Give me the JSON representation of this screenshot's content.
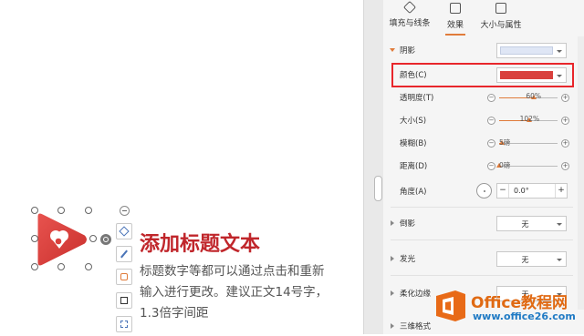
{
  "tabs": [
    {
      "label": "填充与线条",
      "active": false
    },
    {
      "label": "效果",
      "active": true
    },
    {
      "label": "大小与属性",
      "active": false
    }
  ],
  "shadow": {
    "section_label": "阴影",
    "color_label": "颜色(C)",
    "color_value": "#d9403d",
    "transparency": {
      "label": "透明度(T)",
      "value_text": "60%",
      "value": 60
    },
    "size": {
      "label": "大小(S)",
      "value_text": "102%",
      "value": 102
    },
    "blur": {
      "label": "模糊(B)",
      "value_text": "5磅",
      "value": 5
    },
    "distance": {
      "label": "距离(D)",
      "value_text": "0磅",
      "value": 0
    },
    "angle": {
      "label": "角度(A)",
      "value": "0.0°"
    }
  },
  "sections": [
    {
      "label": "倒影",
      "value": "无"
    },
    {
      "label": "发光",
      "value": "无"
    },
    {
      "label": "柔化边缘",
      "value": "无"
    },
    {
      "label": "三维格式",
      "value": ""
    }
  ],
  "canvas": {
    "title": "添加标题文本",
    "body": "标题数字等都可以通过点击和重新输入进行更改。建议正文14号字，1.3倍字间距",
    "shape_color": "#d9403d"
  },
  "watermark": {
    "brand": "Office教程网",
    "url": "www.office26.com"
  }
}
